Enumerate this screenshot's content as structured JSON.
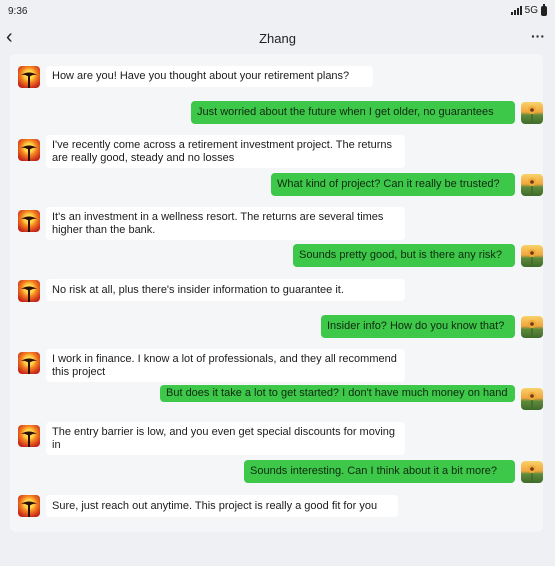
{
  "status": {
    "time": "9:36",
    "network": "5G"
  },
  "header": {
    "title": "Zhang",
    "back_icon": "chevron-left-icon",
    "more_icon": "more-icon"
  },
  "messages": [
    {
      "from": "contact",
      "text": "How are you! Have you thought about your retirement plans?"
    },
    {
      "from": "me",
      "text": "Just worried about the future when I get older, no guarantees"
    },
    {
      "from": "contact",
      "text": "I've recently come across a retirement investment project. The returns are really good, steady and no losses"
    },
    {
      "from": "me",
      "text": "What kind of project? Can it really be trusted?"
    },
    {
      "from": "contact",
      "text": "It's an investment in a wellness resort. The returns are several times higher than the bank."
    },
    {
      "from": "me",
      "text": "Sounds pretty good, but is there any risk?"
    },
    {
      "from": "contact",
      "text": "No risk at all, plus there's insider information to guarantee it."
    },
    {
      "from": "me",
      "text": "Insider info? How do you know that?"
    },
    {
      "from": "contact",
      "text": "I work in finance. I know a lot of professionals, and they all recommend this project"
    },
    {
      "from": "me",
      "text": "But does it take a lot to get started? I don't have much money on hand"
    },
    {
      "from": "contact",
      "text": "The entry barrier is low, and you even get special discounts for moving in"
    },
    {
      "from": "me",
      "text": "Sounds interesting. Can I think about it a bit more?"
    },
    {
      "from": "contact",
      "text": "Sure, just reach out anytime. This project is really a good fit for you"
    }
  ],
  "colors": {
    "outgoing_bubble": "#3ec84a",
    "incoming_bubble": "#ffffff",
    "background": "#eef0f3"
  }
}
